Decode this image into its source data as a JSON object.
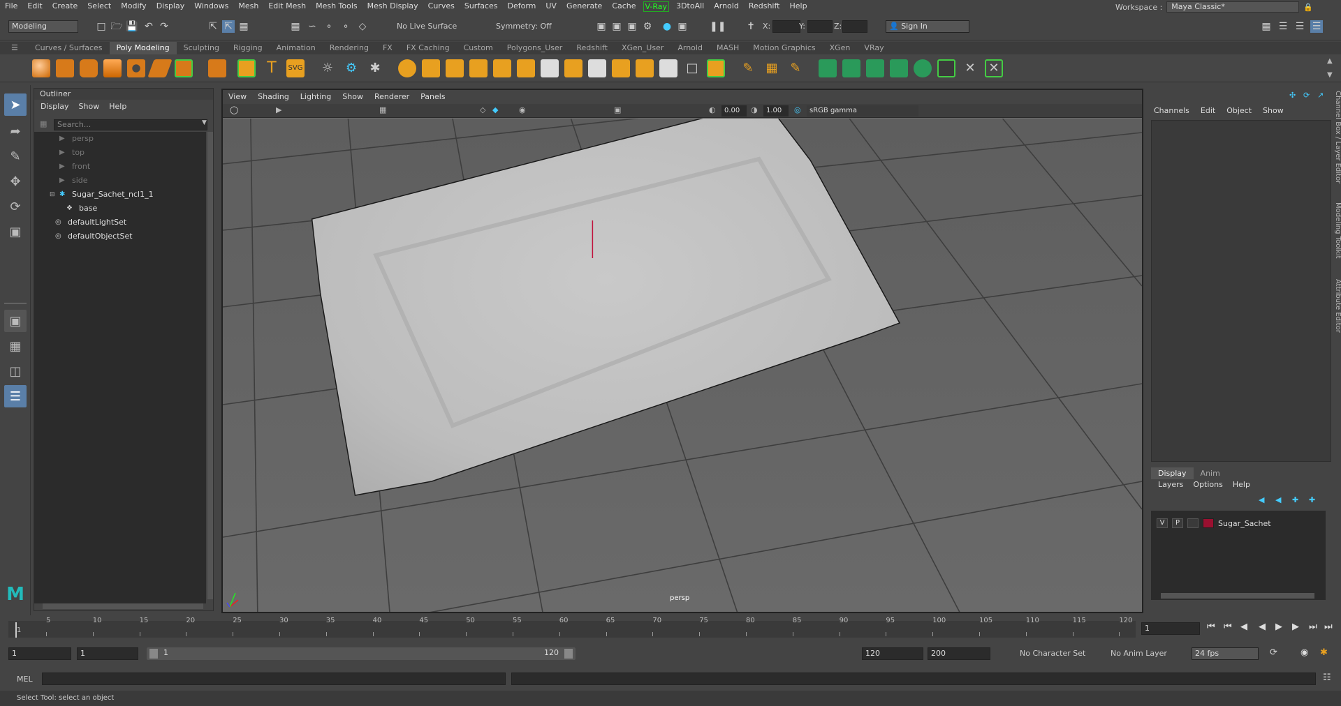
{
  "menubar": {
    "items": [
      "File",
      "Edit",
      "Create",
      "Select",
      "Modify",
      "Display",
      "Windows",
      "Mesh",
      "Edit Mesh",
      "Mesh Tools",
      "Mesh Display",
      "Curves",
      "Surfaces",
      "Deform",
      "UV",
      "Generate",
      "Cache",
      "V-Ray",
      "3DtoAll",
      "Arnold",
      "Redshift",
      "Help"
    ],
    "workspace_label": "Workspace :",
    "workspace_value": "Maya Classic*"
  },
  "statusline": {
    "mode": "Modeling",
    "live_surface": "No Live Surface",
    "symmetry": "Symmetry: Off",
    "x_label": "X:",
    "y_label": "Y:",
    "z_label": "Z:",
    "sign_in": "Sign In"
  },
  "shelf": {
    "tabs": [
      "Curves / Surfaces",
      "Poly Modeling",
      "Sculpting",
      "Rigging",
      "Animation",
      "Rendering",
      "FX",
      "FX Caching",
      "Custom",
      "Polygons_User",
      "Redshift",
      "XGen_User",
      "Arnold",
      "MASH",
      "Motion Graphics",
      "XGen",
      "VRay"
    ],
    "active_tab": "Poly Modeling"
  },
  "outliner": {
    "title": "Outliner",
    "menus": [
      "Display",
      "Show",
      "Help"
    ],
    "search_placeholder": "Search...",
    "items": [
      {
        "label": "persp",
        "dim": true
      },
      {
        "label": "top",
        "dim": true
      },
      {
        "label": "front",
        "dim": true
      },
      {
        "label": "side",
        "dim": true
      },
      {
        "label": "Sugar_Sachet_ncl1_1",
        "dim": false
      },
      {
        "label": "base",
        "dim": false
      },
      {
        "label": "defaultLightSet",
        "dim": false
      },
      {
        "label": "defaultObjectSet",
        "dim": false
      }
    ]
  },
  "viewport": {
    "menus": [
      "View",
      "Shading",
      "Lighting",
      "Show",
      "Renderer",
      "Panels"
    ],
    "near_value": "0.00",
    "far_value": "1.00",
    "color_space": "sRGB gamma",
    "camera_label": "persp"
  },
  "channelbox": {
    "menus": [
      "Channels",
      "Edit",
      "Object",
      "Show"
    ],
    "vertical_tabs": [
      "Channel Box / Layer Editor",
      "Modeling Toolkit",
      "Attribute Editor"
    ]
  },
  "layereditor": {
    "tabs": [
      "Display",
      "Anim"
    ],
    "active_tab": "Display",
    "menus": [
      "Layers",
      "Options",
      "Help"
    ],
    "layer": {
      "v": "V",
      "p": "P",
      "name": "Sugar_Sachet",
      "color": "#9a1030"
    }
  },
  "timeslider": {
    "ticks": [
      "5",
      "10",
      "15",
      "20",
      "25",
      "30",
      "35",
      "40",
      "45",
      "50",
      "55",
      "60",
      "65",
      "70",
      "75",
      "80",
      "85",
      "90",
      "95",
      "100",
      "105",
      "110",
      "115",
      "120"
    ],
    "current_frame": "1",
    "first_tick": "1"
  },
  "rangebar": {
    "start": "1",
    "playback_start": "1",
    "range_start": "1",
    "range_end": "120",
    "playback_end": "120",
    "end": "200",
    "character_set": "No Character Set",
    "anim_layer": "No Anim Layer",
    "fps": "24 fps"
  },
  "cmdline": {
    "label": "MEL"
  },
  "helpline": {
    "text": "Select Tool: select an object"
  }
}
